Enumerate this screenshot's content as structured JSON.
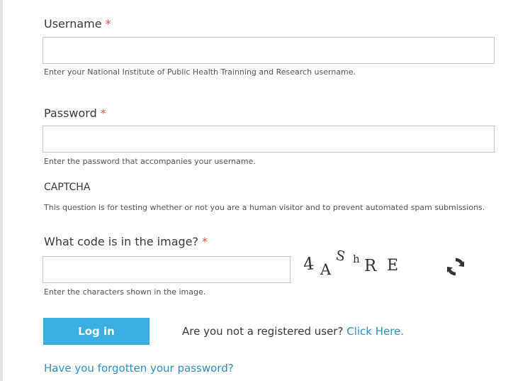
{
  "username": {
    "label": "Username",
    "required_marker": "*",
    "value": "",
    "help": "Enter your National Institute of Public Health Trainning and Research username."
  },
  "password": {
    "label": "Password",
    "required_marker": "*",
    "value": "",
    "help": "Enter the password that accompanies your username."
  },
  "captcha": {
    "heading": "CAPTCHA",
    "description": "This question is for testing whether or not you are a human visitor and to prevent automated spam submissions.",
    "question_label": "What code is in the image?",
    "required_marker": "*",
    "value": "",
    "help": "Enter the characters shown in the image.",
    "image_chars": [
      "4",
      "A",
      "S",
      "h",
      "R",
      "E"
    ],
    "refresh_icon": "refresh-icon"
  },
  "actions": {
    "login_label": "Log in",
    "register_prompt": "Are you not a registered user?",
    "register_link": "Click Here.",
    "forgot_link": "Have you forgotten your password?"
  },
  "colors": {
    "accent": "#3aaee0",
    "link": "#2f8dc8",
    "required": "#d9534f"
  }
}
